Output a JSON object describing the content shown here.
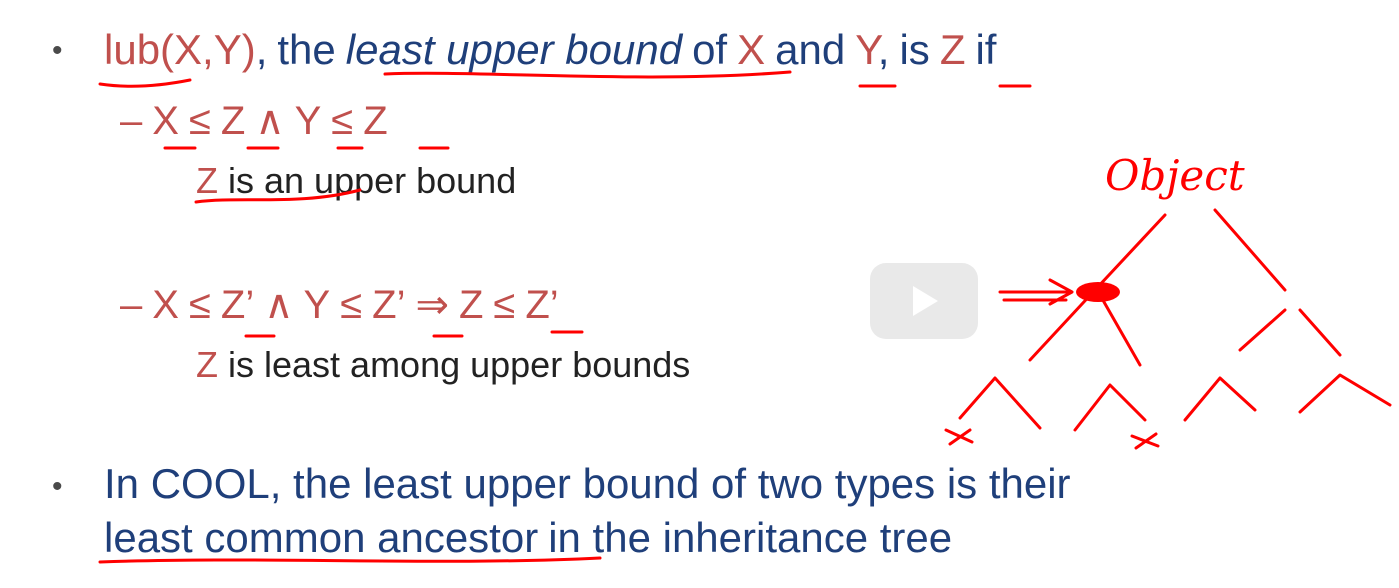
{
  "bullet1": {
    "bullet": "•",
    "lub": "lub(X,Y)",
    "comma": ",",
    "the": "the",
    "lub_phrase": "least upper bound",
    "of": "of",
    "x": "X",
    "and": "and",
    "y": "Y",
    "comma2": ",",
    "is": "is",
    "z": "Z",
    "if": "if"
  },
  "cond1": {
    "dash": "–",
    "x": "X",
    "le1": "≤",
    "z1": "Z",
    "and": "∧",
    "y": "Y",
    "le2": "≤",
    "z2": "Z",
    "note_z": "Z",
    "note_text": "is an upper bound"
  },
  "cond2": {
    "dash": "–",
    "x": "X",
    "le1": "≤",
    "zp1": "Z’",
    "and": "∧",
    "y": "Y",
    "le2": "≤",
    "zp2": "Z’",
    "implies": "⇒",
    "z": "Z",
    "le3": "≤",
    "zp3": "Z’",
    "note_z": "Z",
    "note_text": "is least among upper bounds"
  },
  "bullet2": {
    "bullet": "•",
    "line1": "In COOL, the least upper bound of two types is their",
    "lca": "least common ancestor",
    "line2_rest": "in the inheritance tree"
  },
  "annotation": {
    "tree_root": "Object"
  },
  "colors": {
    "accent_red": "#c0504d",
    "ink_red": "#ff0000",
    "navy": "#1f3f7a"
  },
  "icons": {
    "play": "play-icon"
  }
}
